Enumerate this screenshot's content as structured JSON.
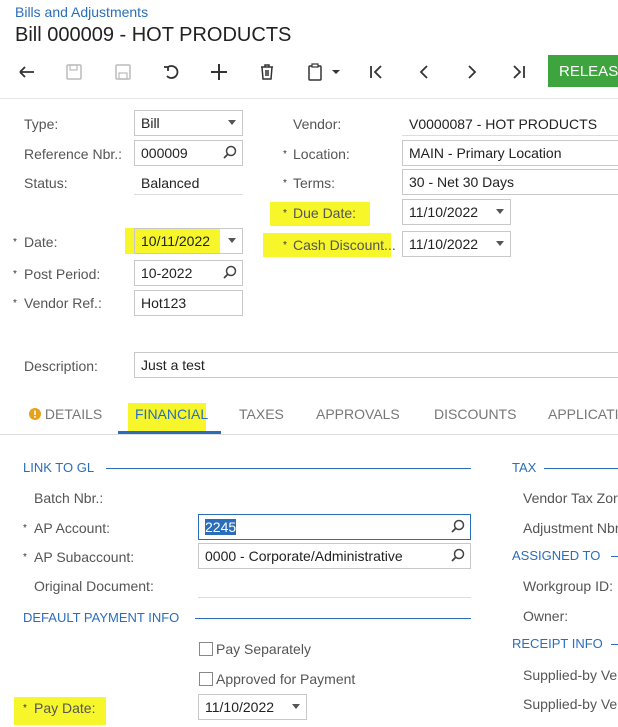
{
  "header": {
    "breadcrumb": "Bills and Adjustments",
    "title": "Bill 000009 - HOT PRODUCTS"
  },
  "toolbar": {
    "icons": [
      "undo-icon",
      "save-close-icon",
      "save-icon",
      "cancel-icon",
      "add-icon",
      "delete-icon",
      "copy-paste-icon",
      "first-icon",
      "previous-icon",
      "next-icon",
      "last-icon"
    ],
    "release_label": "RELEAS"
  },
  "form": {
    "type_label": "Type:",
    "type_value": "Bill",
    "refnbr_label": "Reference Nbr.:",
    "refnbr_value": "000009",
    "status_label": "Status:",
    "status_value": "Balanced",
    "date_label": "Date:",
    "date_value": "10/11/2022",
    "postperiod_label": "Post Period:",
    "postperiod_value": "10-2022",
    "vendorref_label": "Vendor Ref.:",
    "vendorref_value": "Hot123",
    "vendor_label": "Vendor:",
    "vendor_value": "V0000087 - HOT PRODUCTS",
    "location_label": "Location:",
    "location_value": "MAIN - Primary Location",
    "terms_label": "Terms:",
    "terms_value": "30 - Net 30 Days",
    "duedate_label": "Due Date:",
    "duedate_value": "11/10/2022",
    "cashdiscount_label": "Cash Discount...",
    "cashdiscount_value": "11/10/2022",
    "description_label": "Description:",
    "description_value": "Just a test",
    "required_mark": "*"
  },
  "tabs": {
    "details": "DETAILS",
    "financial": "FINANCIAL",
    "taxes": "TAXES",
    "approvals": "APPROVALS",
    "discounts": "DISCOUNTS",
    "application": "APPLICATIO"
  },
  "financial": {
    "link_to_gl": "LINK TO GL",
    "batch_label": "Batch Nbr.:",
    "apaccount_label": "AP Account:",
    "apaccount_value": "2245",
    "apsub_label": "AP Subaccount:",
    "apsub_value": "0000 - Corporate/Administrative",
    "origdoc_label": "Original Document:",
    "default_payment": "DEFAULT PAYMENT INFO",
    "pay_separately": "Pay Separately",
    "approved_payment": "Approved for Payment",
    "paydate_label": "Pay Date:",
    "paydate_value": "11/10/2022",
    "tax_section": "TAX",
    "vendor_tax_zone": "Vendor Tax Zor",
    "adjustment_nbr": "Adjustment Nbr",
    "assigned_to": "ASSIGNED TO",
    "workgroup": "Workgroup ID:",
    "owner": "Owner:",
    "receipt_info": "RECEIPT INFO",
    "supplied1": "Supplied-by Ve",
    "supplied2": "Supplied-by Ve"
  },
  "colors": {
    "accent": "#2a6ebb",
    "release": "#3da43e",
    "highlight": "#f6f62b"
  }
}
